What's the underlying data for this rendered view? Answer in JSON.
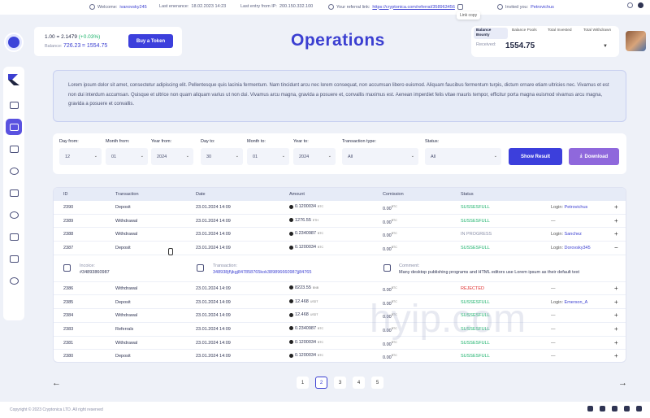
{
  "topbar": {
    "welcome_label": "Welcome:",
    "welcome_user": "ivanovsky245",
    "last_enter_label": "Last enerance:",
    "last_enter_value": "18.02.2023  14:23",
    "last_ip_label": "Last entry from IP:",
    "last_ip_value": "200.150.332.100",
    "ref_label": "Your referral link:",
    "ref_link": "https://cryptonica.com/referral/358963456",
    "invited_label": "Invited you:",
    "invited_user": "Petrovichus",
    "tooltip": "Link copy"
  },
  "balance": {
    "line1_left": "1.00",
    "line1_eq": "= 2.1479",
    "line1_change": "(+0.03%)",
    "line2_label": "Balance:",
    "line2_value": "726.23",
    "line2_eq": "= 1554.75",
    "buy_label": "Buy a Token"
  },
  "title": "Operations",
  "stats": {
    "tabs": [
      {
        "label": "Balance Bounty"
      },
      {
        "label": "Balance Pools"
      },
      {
        "label": "Total Invested"
      },
      {
        "label": "Total Withdrawn"
      }
    ],
    "received_label": "Received:",
    "received_value": "1554.75"
  },
  "info_text": "Lorem ipsum dolor sit amet, consectetur adipiscing elit. Pellentesque quis lacinia fermentum. Nam tincidunt arcu nec lorem consequat, non accumsan libero euismod. Aliquam faucibus fermentum turpis, dictum ornare etiam ultricies nec. Vivamus et est non dui interdum accumsan. Quisque et ultrice non quam aliquam varius ut non dui. Vivamus arcu magna, gravida a posuere et, convallis maximus est. Aenean imperdiet felis vitae mauris tempor, efficitur porta magna euismod vivamus arcu magna, gravida a posuere et convallis.",
  "filters": {
    "day_from": {
      "label": "Day from:",
      "value": "12"
    },
    "month_from": {
      "label": "Month from:",
      "value": "01"
    },
    "year_from": {
      "label": "Year from:",
      "value": "2024"
    },
    "day_to": {
      "label": "Day to:",
      "value": "30"
    },
    "month_to": {
      "label": "Month to:",
      "value": "01"
    },
    "year_to": {
      "label": "Year to:",
      "value": "2024"
    },
    "type": {
      "label": "Transaction type:",
      "value": "All"
    },
    "status": {
      "label": "Status:",
      "value": "All"
    },
    "show_label": "Show Result",
    "download_label": "Download"
  },
  "table": {
    "headers": {
      "id": "ID",
      "transaction": "Transaction",
      "date": "Date",
      "amount": "Amount",
      "commission": "Comission",
      "status": "Status"
    },
    "rows": [
      {
        "id": "2390",
        "tx": "Deposit",
        "date": "23.01.2024  14:09",
        "amount": "0.1200034",
        "unit": "BTC",
        "com": "0.00",
        "com_unit": "BTC",
        "status": "SUSSESFULL",
        "login": "Login:",
        "login_user": "Petrovichus"
      },
      {
        "id": "2389",
        "tx": "Withdrawal",
        "date": "23.01.2024  14:09",
        "amount": "1276.55",
        "unit": "ETH",
        "com": "0.00",
        "com_unit": "BTC",
        "status": "SUSSESFULL",
        "login": "—",
        "login_user": ""
      },
      {
        "id": "2388",
        "tx": "Withdrawal",
        "date": "23.01.2024  14:09",
        "amount": "0.2340987",
        "unit": "BTC",
        "com": "0.00",
        "com_unit": "BTC",
        "status": "IN PROGRESS",
        "login": "Login:",
        "login_user": "Sanchez"
      },
      {
        "id": "2387",
        "tx": "Deposit",
        "date": "23.01.2024  14:09",
        "amount": "0.1200034",
        "unit": "BTC",
        "com": "0.00",
        "com_unit": "BTC",
        "status": "SUSSESFULL",
        "login": "Login:",
        "login_user": "Dorovsky345"
      },
      {
        "id": "2386",
        "tx": "Withdrawal",
        "date": "23.01.2024  14:09",
        "amount": "8223.55",
        "unit": "BNB",
        "com": "0.00",
        "com_unit": "BTC",
        "status": "REJECTED",
        "login": "—",
        "login_user": ""
      },
      {
        "id": "2385",
        "tx": "Deposit",
        "date": "23.01.2024  14:09",
        "amount": "12.468",
        "unit": "USDT",
        "com": "0.00",
        "com_unit": "BTC",
        "status": "SUSSESFULL",
        "login": "Login:",
        "login_user": "Emerson_A"
      },
      {
        "id": "2384",
        "tx": "Withdrawal",
        "date": "23.01.2024  14:09",
        "amount": "12.468",
        "unit": "USDT",
        "com": "0.00",
        "com_unit": "BTC",
        "status": "SUSSESFULL",
        "login": "—",
        "login_user": ""
      },
      {
        "id": "2383",
        "tx": "Referrals",
        "date": "23.01.2024  14:09",
        "amount": "0.2340987",
        "unit": "BTC",
        "com": "0.00",
        "com_unit": "BTC",
        "status": "SUSSESFULL",
        "login": "—",
        "login_user": ""
      },
      {
        "id": "2381",
        "tx": "Withdrawal",
        "date": "23.01.2024  14:09",
        "amount": "0.1200034",
        "unit": "BTC",
        "com": "0.00",
        "com_unit": "BTC",
        "status": "SUSSESFULL",
        "login": "—",
        "login_user": ""
      },
      {
        "id": "2380",
        "tx": "Deposit",
        "date": "23.01.2024  14:09",
        "amount": "0.1200034",
        "unit": "BTC",
        "com": "0.00",
        "com_unit": "BTC",
        "status": "SUSSESFULL",
        "login": "—",
        "login_user": ""
      }
    ],
    "expanded": {
      "invoice_label": "Incoice:",
      "invoice_value": "#34893860987",
      "tx_label": "Transaction:",
      "tx_value": "348938jf\\jkgj847858765kok389896660987jj84765",
      "comment_label": "Comment:",
      "comment_value": "Many desktop publishing programs and HTML editors use Lorem ipsum as their default text"
    }
  },
  "pagination": [
    "1",
    "2",
    "3",
    "4",
    "5"
  ],
  "footer": {
    "copyright": "Copyright © 2023 Cryptonica LTD. All right reserved"
  },
  "watermark": "hyip.com",
  "colors": {
    "accent": "#3b3fd1",
    "success": "#1bb26b",
    "rejected": "#e03030",
    "download": "#8f68dc"
  }
}
